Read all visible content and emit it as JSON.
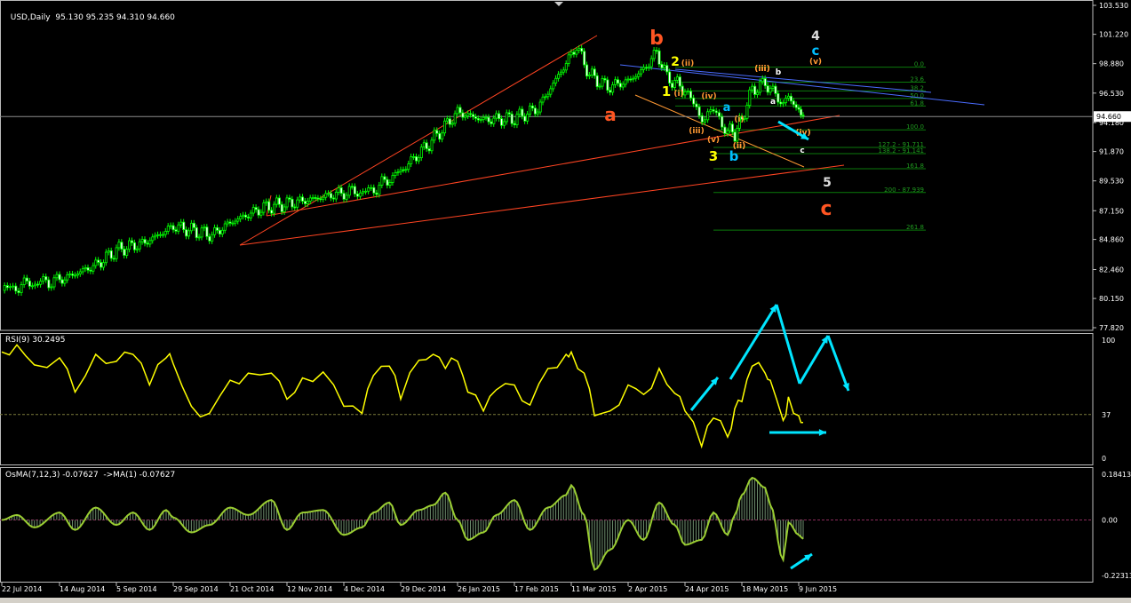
{
  "header": {
    "symbol_label": "USD,Daily",
    "ohlc": "95.130 95.235 94.310 94.660",
    "rsi_label": "RSI(9) 30.2495",
    "osma_label": "OsMA(7,12,3) -0.07627  ->MA(1) -0.07627"
  },
  "colors": {
    "background": "#000000",
    "candle_up": "#00ff00",
    "rsi_line": "#ffff00",
    "osma": "#9acd32",
    "annotation_arrow": "#00e5ff",
    "trendline": "#ff4422",
    "channel": "#4a6cff",
    "fibo": "#0b7a0b"
  },
  "price_axis": {
    "ticks": [
      "103.530",
      "101.220",
      "98.880",
      "96.530",
      "94.180",
      "91.870",
      "89.530",
      "87.150",
      "84.860",
      "82.460",
      "80.150",
      "77.820"
    ],
    "current_price": "94.660"
  },
  "rsi_axis": {
    "ticks": [
      "100",
      "37",
      "0"
    ],
    "level": 37
  },
  "osma_axis": {
    "ticks": [
      "0.18413",
      "0.00",
      "-0.22313"
    ]
  },
  "x_axis": {
    "labels": [
      "22 Jul 2014",
      "14 Aug 2014",
      "5 Sep 2014",
      "29 Sep 2014",
      "21 Oct 2014",
      "12 Nov 2014",
      "4 Dec 2014",
      "29 Dec 2014",
      "26 Jan 2015",
      "17 Feb 2015",
      "11 Mar 2015",
      "2 Apr 2015",
      "24 Apr 2015",
      "18 May 2015",
      "9 Jun 2015"
    ]
  },
  "fibo_levels": [
    {
      "label": "0.0",
      "price": 98.6
    },
    {
      "label": "23.6",
      "price": 97.4
    },
    {
      "label": "38.2",
      "price": 96.7
    },
    {
      "label": "50.0",
      "price": 96.1
    },
    {
      "label": "61.8",
      "price": 95.5
    },
    {
      "label": "100.0",
      "price": 93.6
    },
    {
      "label": "127.2 - 91.711",
      "price": 92.2
    },
    {
      "label": "138.2 - 91.141",
      "price": 91.7
    },
    {
      "label": "161.8",
      "price": 90.5
    },
    {
      "label": "200 - 87.939",
      "price": 88.6
    },
    {
      "label": "261.8",
      "price": 85.6
    }
  ],
  "wave_labels": [
    {
      "text": "a",
      "color": "#ff5522"
    },
    {
      "text": "b",
      "color": "#ff5522"
    },
    {
      "text": "c",
      "color": "#ff5522"
    },
    {
      "text": "1",
      "color": "#ffff00"
    },
    {
      "text": "2",
      "color": "#ffff00"
    },
    {
      "text": "3",
      "color": "#ffff00"
    },
    {
      "text": "4",
      "color": "#dddddd"
    },
    {
      "text": "5",
      "color": "#dddddd"
    },
    {
      "text": "a",
      "color": "#00bfff"
    },
    {
      "text": "b",
      "color": "#00bfff"
    },
    {
      "text": "c",
      "color": "#00bfff"
    },
    {
      "text": "(i)",
      "color": "#ff9933"
    },
    {
      "text": "(ii)",
      "color": "#ff9933"
    },
    {
      "text": "(iii)",
      "color": "#ff9933"
    },
    {
      "text": "(iv)",
      "color": "#ff9933"
    },
    {
      "text": "(v)",
      "color": "#ff9933"
    },
    {
      "text": "(ii)",
      "color": "#ff9933"
    },
    {
      "text": "(iii)",
      "color": "#ff9933"
    },
    {
      "text": "(iv)",
      "color": "#ff9933"
    },
    {
      "text": "(i)",
      "color": "#ff9933"
    },
    {
      "text": "(ii)",
      "color": "#ff9933"
    },
    {
      "text": "(iii)",
      "color": "#ff9933"
    },
    {
      "text": "(iv)",
      "color": "#ff9933"
    },
    {
      "text": "(v)",
      "color": "#ff9933"
    },
    {
      "text": "a",
      "color": "#ffffff"
    },
    {
      "text": "b",
      "color": "#ffffff"
    },
    {
      "text": "c",
      "color": "#ffffff"
    }
  ],
  "chart_data": [
    {
      "type": "line",
      "title": "USD,Daily",
      "ylim": [
        77.82,
        103.53
      ],
      "x_range": [
        "22 Jul 2014",
        "10 Jun 2015"
      ],
      "series": [
        {
          "name": "USD",
          "points": [
            [
              "22 Jul 2014",
              80.8
            ],
            [
              "1 Aug 2014",
              81.3
            ],
            [
              "14 Aug 2014",
              81.6
            ],
            [
              "28 Aug 2014",
              82.8
            ],
            [
              "5 Sep 2014",
              84.0
            ],
            [
              "17 Sep 2014",
              84.6
            ],
            [
              "29 Sep 2014",
              85.9
            ],
            [
              "8 Oct 2014",
              85.5
            ],
            [
              "14 Oct 2014",
              85.2
            ],
            [
              "21 Oct 2014",
              86.2
            ],
            [
              "3 Nov 2014",
              87.4
            ],
            [
              "12 Nov 2014",
              87.7
            ],
            [
              "20 Nov 2014",
              88.0
            ],
            [
              "4 Dec 2014",
              88.6
            ],
            [
              "16 Dec 2014",
              88.7
            ],
            [
              "29 Dec 2014",
              90.3
            ],
            [
              "12 Jan 2015",
              92.5
            ],
            [
              "26 Jan 2015",
              95.0
            ],
            [
              "5 Feb 2015",
              94.4
            ],
            [
              "17 Feb 2015",
              94.5
            ],
            [
              "26 Feb 2015",
              95.3
            ],
            [
              "5 Mar 2015",
              97.6
            ],
            [
              "11 Mar 2015",
              99.6
            ],
            [
              "13 Mar 2015",
              100.3
            ],
            [
              "18 Mar 2015",
              98.0
            ],
            [
              "25 Mar 2015",
              97.0
            ],
            [
              "2 Apr 2015",
              97.5
            ],
            [
              "8 Apr 2015",
              98.4
            ],
            [
              "13 Apr 2015",
              99.8
            ],
            [
              "17 Apr 2015",
              97.8
            ],
            [
              "24 Apr 2015",
              96.8
            ],
            [
              "30 Apr 2015",
              94.7
            ],
            [
              "6 May 2015",
              95.0
            ],
            [
              "12 May 2015",
              93.6
            ],
            [
              "15 May 2015",
              93.3
            ],
            [
              "18 May 2015",
              94.5
            ],
            [
              "22 May 2015",
              96.8
            ],
            [
              "27 May 2015",
              97.3
            ],
            [
              "29 May 2015",
              96.9
            ],
            [
              "3 Jun 2015",
              95.6
            ],
            [
              "5 Jun 2015",
              96.3
            ],
            [
              "9 Jun 2015",
              95.1
            ],
            [
              "10 Jun 2015",
              94.66
            ]
          ]
        }
      ]
    },
    {
      "type": "line",
      "title": "RSI(9) 30.2495",
      "ylim": [
        0,
        100
      ],
      "x_range": [
        "22 Jul 2014",
        "10 Jun 2015"
      ],
      "series": [
        {
          "name": "RSI(9)",
          "points": [
            [
              "22 Jul 2014",
              90
            ],
            [
              "28 Jul 2014",
              96
            ],
            [
              "4 Aug 2014",
              79
            ],
            [
              "14 Aug 2014",
              85
            ],
            [
              "20 Aug 2014",
              56
            ],
            [
              "28 Aug 2014",
              88
            ],
            [
              "5 Sep 2014",
              82
            ],
            [
              "12 Sep 2014",
              88
            ],
            [
              "19 Sep 2014",
              62
            ],
            [
              "26 Sep 2014",
              85
            ],
            [
              "29 Sep 2014",
              80
            ],
            [
              "6 Oct 2014",
              44
            ],
            [
              "13 Oct 2014",
              38
            ],
            [
              "21 Oct 2014",
              66
            ],
            [
              "28 Oct 2014",
              72
            ],
            [
              "6 Nov 2014",
              72
            ],
            [
              "12 Nov 2014",
              50
            ],
            [
              "18 Nov 2014",
              68
            ],
            [
              "26 Nov 2014",
              73
            ],
            [
              "4 Dec 2014",
              44
            ],
            [
              "12 Dec 2014",
              38
            ],
            [
              "17 Dec 2014",
              70
            ],
            [
              "24 Dec 2014",
              78
            ],
            [
              "29 Dec 2014",
              50
            ],
            [
              "7 Jan 2015",
              83
            ],
            [
              "14 Jan 2015",
              88
            ],
            [
              "20 Jan 2015",
              76
            ],
            [
              "26 Jan 2015",
              82
            ],
            [
              "30 Jan 2015",
              56
            ],
            [
              "5 Feb 2015",
              40
            ],
            [
              "10 Feb 2015",
              58
            ],
            [
              "17 Feb 2015",
              62
            ],
            [
              "23 Feb 2015",
              45
            ],
            [
              "2 Mar 2015",
              76
            ],
            [
              "9 Mar 2015",
              88
            ],
            [
              "11 Mar 2015",
              90
            ],
            [
              "16 Mar 2015",
              72
            ],
            [
              "20 Mar 2015",
              36
            ],
            [
              "26 Mar 2015",
              40
            ],
            [
              "2 Apr 2015",
              62
            ],
            [
              "8 Apr 2015",
              54
            ],
            [
              "14 Apr 2015",
              76
            ],
            [
              "20 Apr 2015",
              55
            ],
            [
              "24 Apr 2015",
              40
            ],
            [
              "1 May 2015",
              10
            ],
            [
              "6 May 2015",
              34
            ],
            [
              "12 May 2015",
              18
            ],
            [
              "15 May 2015",
              42
            ],
            [
              "18 May 2015",
              48
            ],
            [
              "22 May 2015",
              78
            ],
            [
              "27 May 2015",
              72
            ],
            [
              "29 May 2015",
              66
            ],
            [
              "3 Jun 2015",
              32
            ],
            [
              "5 Jun 2015",
              52
            ],
            [
              "9 Jun 2015",
              36
            ],
            [
              "10 Jun 2015",
              30.25
            ]
          ]
        }
      ]
    },
    {
      "type": "bar",
      "title": "OsMA(7,12,3) -0.07627",
      "ylim": [
        -0.22313,
        0.18413
      ],
      "x_range": [
        "22 Jul 2014",
        "10 Jun 2015"
      ],
      "series": [
        {
          "name": "OsMA(7,12,3)",
          "points": [
            [
              "22 Jul 2014",
              0.0
            ],
            [
              "28 Jul 2014",
              0.02
            ],
            [
              "4 Aug 2014",
              -0.03
            ],
            [
              "14 Aug 2014",
              0.03
            ],
            [
              "20 Aug 2014",
              -0.04
            ],
            [
              "28 Aug 2014",
              0.05
            ],
            [
              "5 Sep 2014",
              -0.02
            ],
            [
              "12 Sep 2014",
              0.03
            ],
            [
              "19 Sep 2014",
              -0.04
            ],
            [
              "26 Sep 2014",
              0.04
            ],
            [
              "29 Sep 2014",
              0.01
            ],
            [
              "6 Oct 2014",
              -0.05
            ],
            [
              "13 Oct 2014",
              -0.02
            ],
            [
              "21 Oct 2014",
              0.05
            ],
            [
              "28 Oct 2014",
              0.02
            ],
            [
              "6 Nov 2014",
              0.08
            ],
            [
              "12 Nov 2014",
              -0.04
            ],
            [
              "18 Nov 2014",
              0.03
            ],
            [
              "26 Nov 2014",
              0.04
            ],
            [
              "4 Dec 2014",
              -0.06
            ],
            [
              "12 Dec 2014",
              -0.03
            ],
            [
              "17 Dec 2014",
              0.03
            ],
            [
              "24 Dec 2014",
              0.07
            ],
            [
              "29 Dec 2014",
              -0.02
            ],
            [
              "7 Jan 2015",
              0.04
            ],
            [
              "14 Jan 2015",
              0.06
            ],
            [
              "20 Jan 2015",
              0.11
            ],
            [
              "26 Jan 2015",
              0.0
            ],
            [
              "30 Jan 2015",
              -0.08
            ],
            [
              "5 Feb 2015",
              -0.05
            ],
            [
              "10 Feb 2015",
              0.02
            ],
            [
              "17 Feb 2015",
              0.08
            ],
            [
              "23 Feb 2015",
              -0.04
            ],
            [
              "2 Mar 2015",
              0.05
            ],
            [
              "9 Mar 2015",
              0.1
            ],
            [
              "11 Mar 2015",
              0.14
            ],
            [
              "16 Mar 2015",
              0.02
            ],
            [
              "20 Mar 2015",
              -0.2
            ],
            [
              "26 Mar 2015",
              -0.12
            ],
            [
              "2 Apr 2015",
              0.0
            ],
            [
              "8 Apr 2015",
              -0.08
            ],
            [
              "14 Apr 2015",
              0.07
            ],
            [
              "20 Apr 2015",
              -0.02
            ],
            [
              "24 Apr 2015",
              -0.1
            ],
            [
              "1 May 2015",
              -0.08
            ],
            [
              "6 May 2015",
              0.03
            ],
            [
              "12 May 2015",
              -0.06
            ],
            [
              "15 May 2015",
              0.02
            ],
            [
              "18 May 2015",
              0.1
            ],
            [
              "22 May 2015",
              0.17
            ],
            [
              "27 May 2015",
              0.13
            ],
            [
              "29 May 2015",
              0.06
            ],
            [
              "3 Jun 2015",
              -0.16
            ],
            [
              "5 Jun 2015",
              -0.01
            ],
            [
              "9 Jun 2015",
              -0.06
            ],
            [
              "10 Jun 2015",
              -0.07627
            ]
          ]
        }
      ]
    }
  ]
}
